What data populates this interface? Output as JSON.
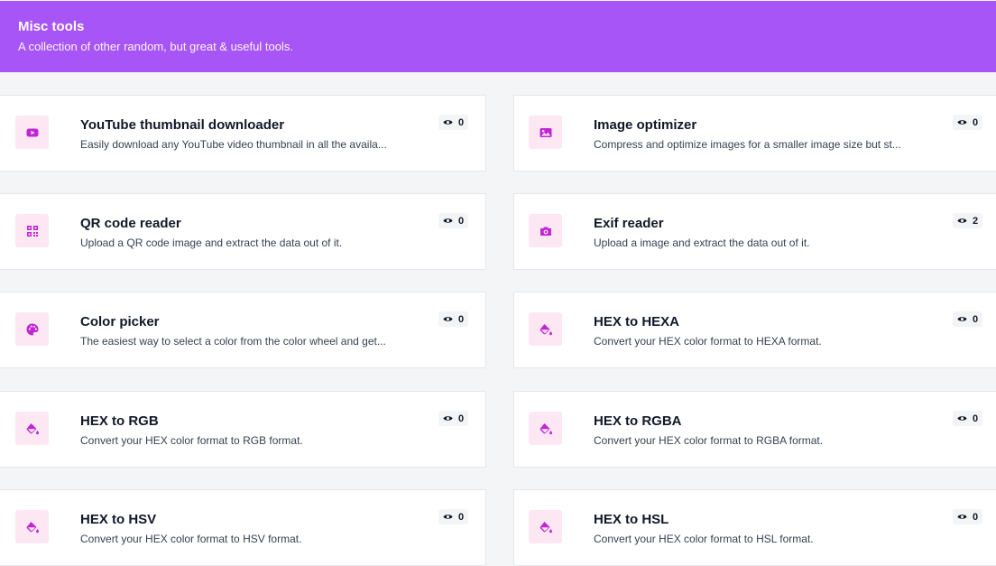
{
  "header": {
    "title": "Misc tools",
    "subtitle": "A collection of other random, but great & useful tools."
  },
  "colors": {
    "header_bg": "#a855f7",
    "icon_bg": "#fce7f3",
    "icon_fg": "#c026d3"
  },
  "tools": [
    {
      "title": "YouTube thumbnail downloader",
      "description": "Easily download any YouTube video thumbnail in all the availa...",
      "views": "0",
      "icon": "youtube-icon"
    },
    {
      "title": "Image optimizer",
      "description": "Compress and optimize images for a smaller image size but st...",
      "views": "0",
      "icon": "image-icon"
    },
    {
      "title": "QR code reader",
      "description": "Upload a QR code image and extract the data out of it.",
      "views": "0",
      "icon": "qr-code-icon"
    },
    {
      "title": "Exif reader",
      "description": "Upload a image and extract the data out of it.",
      "views": "2",
      "icon": "camera-icon"
    },
    {
      "title": "Color picker",
      "description": "The easiest way to select a color from the color wheel and get...",
      "views": "0",
      "icon": "palette-icon"
    },
    {
      "title": "HEX to HEXA",
      "description": "Convert your HEX color format to HEXA format.",
      "views": "0",
      "icon": "paint-bucket-icon"
    },
    {
      "title": "HEX to RGB",
      "description": "Convert your HEX color format to RGB format.",
      "views": "0",
      "icon": "paint-bucket-icon"
    },
    {
      "title": "HEX to RGBA",
      "description": "Convert your HEX color format to RGBA format.",
      "views": "0",
      "icon": "paint-bucket-icon"
    },
    {
      "title": "HEX to HSV",
      "description": "Convert your HEX color format to HSV format.",
      "views": "0",
      "icon": "paint-bucket-icon"
    },
    {
      "title": "HEX to HSL",
      "description": "Convert your HEX color format to HSL format.",
      "views": "0",
      "icon": "paint-bucket-icon"
    }
  ]
}
